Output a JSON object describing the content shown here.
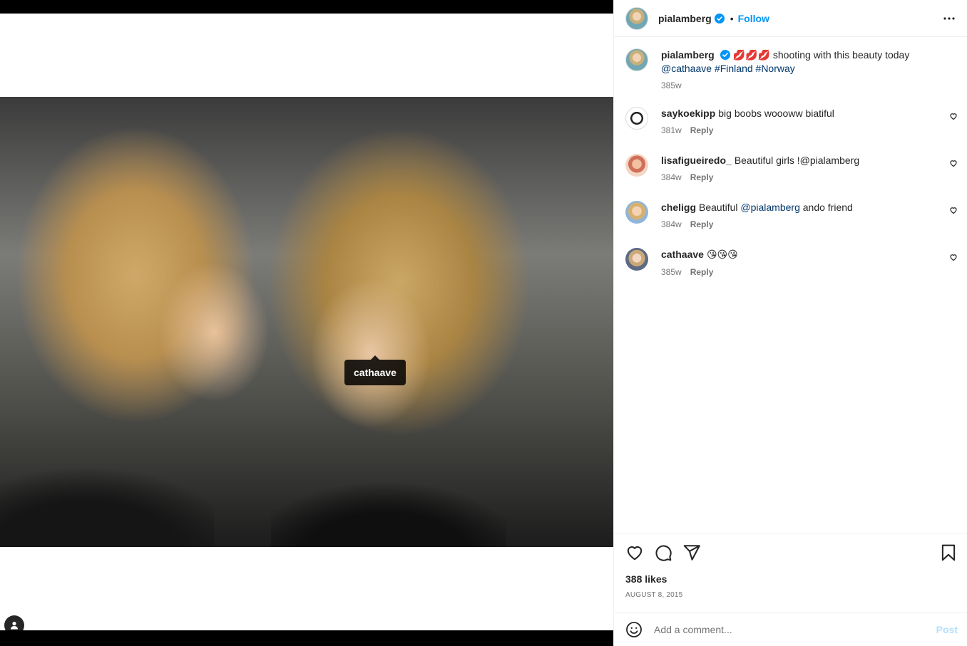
{
  "post": {
    "author": "pialamberg",
    "follow_label": "Follow",
    "separator": "•",
    "caption": {
      "username": "pialamberg",
      "emojis": "💋💋💋",
      "text": " shooting with this beauty today",
      "mention": "@cathaave",
      "hashtag1": "#Finland",
      "hashtag2": "#Norway",
      "time": "385w"
    },
    "tagged_user": "cathaave",
    "likes": "388 likes",
    "date": "August 8, 2015"
  },
  "comments": [
    {
      "username": "saykoekipp",
      "text": "big boobs woooww biatiful",
      "time": "381w",
      "reply": "Reply"
    },
    {
      "username": "lisafigueiredo_",
      "text": "Beautiful girls !@pialamberg",
      "time": "384w",
      "reply": "Reply"
    },
    {
      "username": "cheligg",
      "text_before": "Beautiful ",
      "mention": "@pialamberg",
      "text_after": " ando friend",
      "time": "384w",
      "reply": "Reply"
    },
    {
      "username": "cathaave",
      "text": "😘😘😘",
      "time": "385w",
      "reply": "Reply"
    }
  ],
  "add_comment": {
    "placeholder": "Add a comment...",
    "post_label": "Post"
  },
  "colors": {
    "accent": "#0095f6",
    "link": "#00376b",
    "verified": "#0095f6"
  },
  "icons": [
    "verified-badge-icon",
    "more-options-icon",
    "heart-icon",
    "comment-icon",
    "share-icon",
    "bookmark-icon",
    "emoji-icon",
    "user-tag-icon"
  ]
}
